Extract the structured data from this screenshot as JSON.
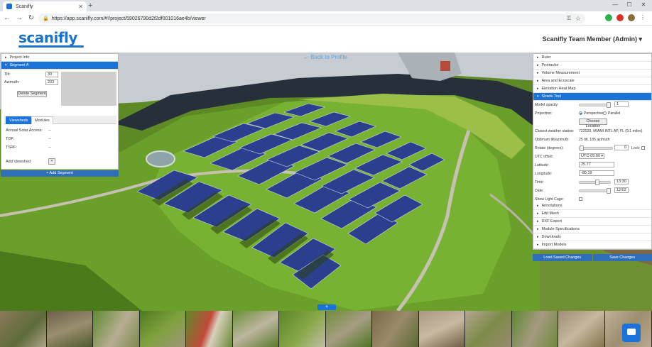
{
  "browser": {
    "tab_title": "Scanifly",
    "url": "https://app.scanifly.com/#!/project/59026790d2f2df001016ae4b/viewer"
  },
  "app": {
    "logo": "scanifly",
    "user_menu": "Scanifly Team Member (Admin) ▾",
    "back_link": "← Back to Profile"
  },
  "left_panel": {
    "project_info": "Project Info",
    "segment": "Segment A",
    "tilt_label": "Tilt:",
    "tilt_value": "30",
    "azimuth_label": "Azimuth:",
    "azimuth_value": "233",
    "delete_button": "Delete Segment",
    "tabs": [
      "Viewsheds",
      "Modules"
    ],
    "annual_solar_access_label": "Annual Solar Access:",
    "annual_solar_access_value": "--",
    "tof_label": "TOF:",
    "tof_value": "--",
    "tsrf_label": "TSRF:",
    "tsrf_value": "--",
    "add_viewshed_label": "Add Viewshed",
    "add_viewshed_button": "+",
    "add_segment_button": "+ Add Segment"
  },
  "right_panel": {
    "tools_top": [
      "Ruler",
      "Protractor",
      "Volume Measurement",
      "Area and Ecoscale",
      "Elevation Heat Map"
    ],
    "shade_tool": "Shade Tool",
    "model_opacity_label": "Model opacity:",
    "model_opacity_value": "1",
    "projection_label": "Projection:",
    "projection_options": [
      "Perspective",
      "Parallel"
    ],
    "choose_location_button": "Choose Location",
    "closest_station_label": "Closest weather station:",
    "closest_station_value": "722020, MIAMI INTL AP, FL (9.1 miles)",
    "optimum_label": "Optimum tilt/azimuth:",
    "optimum_value": "25 tilt, 185 azimuth",
    "rotate_label": "Rotate (degrees):",
    "rotate_value": "0",
    "lock_label": "Lock:",
    "utc_label": "UTC offset:",
    "utc_value": "UTC-05:00",
    "latitude_label": "Latitude:",
    "latitude_value": "25.77",
    "longitude_label": "Longitude:",
    "longitude_value": "-80.19",
    "time_label": "Time:",
    "time_value": "13:30",
    "date_label": "Date:",
    "date_value": "12/02",
    "light_cage_label": "Show Light Cage:",
    "tools_bottom": [
      "Annotations",
      "Edit Mesh",
      "DXF Export",
      "Module Specifications",
      "Downloads",
      "Import Models"
    ],
    "load_button": "Load Saved Changes",
    "save_button": "Save Changes"
  },
  "filmstrip": {
    "add_button": "+"
  },
  "colors": {
    "accent": "#1a73d9",
    "brand": "#1a73c8",
    "button_dark": "#2f6fb9"
  }
}
